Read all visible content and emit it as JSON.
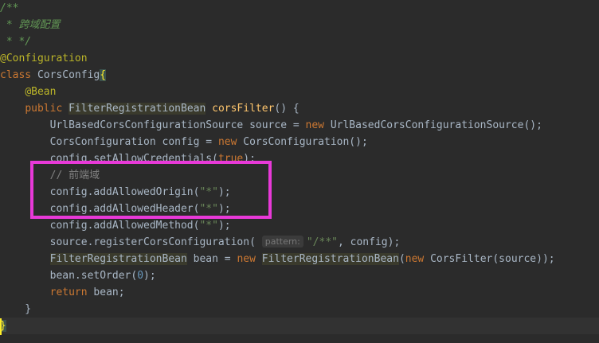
{
  "editor": {
    "lines": [
      [
        {
          "cls": "comment",
          "text": "/**"
        }
      ],
      [
        {
          "cls": "comment",
          "text": " * 跨域配置"
        }
      ],
      [
        {
          "cls": "comment",
          "text": " * */"
        }
      ],
      [
        {
          "cls": "ann",
          "text": "@Configuration"
        }
      ],
      [
        {
          "cls": "kw",
          "text": "class "
        },
        {
          "cls": "",
          "text": "CorsConfig"
        },
        {
          "cls": "brace-hl",
          "text": "{"
        }
      ],
      [
        {
          "cls": "",
          "text": "    "
        },
        {
          "cls": "ann",
          "text": "@Bean"
        }
      ],
      [
        {
          "cls": "",
          "text": "    "
        },
        {
          "cls": "kw",
          "text": "public "
        },
        {
          "cls": "hl",
          "text": "FilterRegistrationBean"
        },
        {
          "cls": "",
          "text": " "
        },
        {
          "cls": "fn",
          "text": "corsFilter"
        },
        {
          "cls": "",
          "text": "() {"
        }
      ],
      [
        {
          "cls": "",
          "text": "        UrlBasedCorsConfigurationSource source = "
        },
        {
          "cls": "kw",
          "text": "new "
        },
        {
          "cls": "",
          "text": "UrlBasedCorsConfigurationSource();"
        }
      ],
      [
        {
          "cls": "",
          "text": "        CorsConfiguration config = "
        },
        {
          "cls": "kw",
          "text": "new "
        },
        {
          "cls": "",
          "text": "CorsConfiguration();"
        }
      ],
      [
        {
          "cls": "",
          "text": "        config.setAllowCredentials("
        },
        {
          "cls": "kw",
          "text": "true"
        },
        {
          "cls": "",
          "text": ");"
        }
      ],
      [
        {
          "cls": "",
          "text": "        "
        },
        {
          "cls": "lcomment",
          "text": "// 前端域"
        }
      ],
      [
        {
          "cls": "",
          "text": "        config.addAllowedOrigin("
        },
        {
          "cls": "str",
          "text": "\"*\""
        },
        {
          "cls": "",
          "text": ");"
        }
      ],
      [
        {
          "cls": "",
          "text": "        config.addAllowedHeader("
        },
        {
          "cls": "str",
          "text": "\"*\""
        },
        {
          "cls": "",
          "text": ");"
        }
      ],
      [
        {
          "cls": "",
          "text": "        config.addAllowedMethod("
        },
        {
          "cls": "str",
          "text": "\"*\""
        },
        {
          "cls": "",
          "text": ");"
        }
      ],
      [
        {
          "cls": "",
          "text": "        source.registerCorsConfiguration( "
        },
        {
          "cls": "hint",
          "text": "pattern:"
        },
        {
          "cls": "str",
          "text": "\"/**\""
        },
        {
          "cls": "",
          "text": ", config);"
        }
      ],
      [
        {
          "cls": "",
          "text": "        "
        },
        {
          "cls": "hl",
          "text": "FilterRegistrationBean"
        },
        {
          "cls": "",
          "text": " bean = "
        },
        {
          "cls": "kw",
          "text": "new "
        },
        {
          "cls": "hl",
          "text": "FilterRegistrationBean"
        },
        {
          "cls": "",
          "text": "("
        },
        {
          "cls": "kw",
          "text": "new "
        },
        {
          "cls": "",
          "text": "CorsFilter(source));"
        }
      ],
      [
        {
          "cls": "",
          "text": "        bean.setOrder("
        },
        {
          "cls": "num",
          "text": "0"
        },
        {
          "cls": "",
          "text": ");"
        }
      ],
      [
        {
          "cls": "",
          "text": "        "
        },
        {
          "cls": "kw",
          "text": "return "
        },
        {
          "cls": "",
          "text": "bean;"
        }
      ],
      [
        {
          "cls": "",
          "text": "    }"
        }
      ],
      [
        {
          "cls": "brace-hl",
          "text": "}"
        }
      ]
    ],
    "current_line_index": 19,
    "annotation_box_color": "#e839d8"
  }
}
